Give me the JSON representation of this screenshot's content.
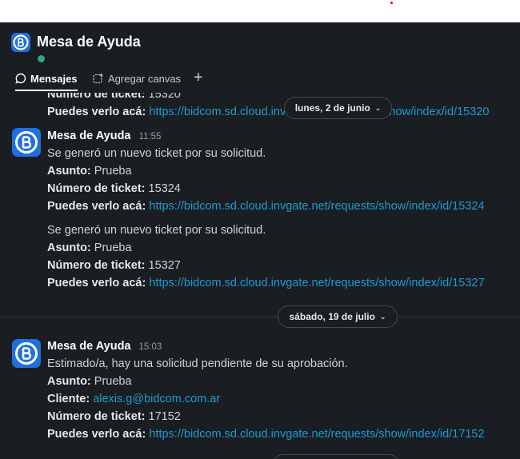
{
  "app": {
    "title": "Mesa de Ayuda"
  },
  "tabs": [
    {
      "label": "Mensajes",
      "icon": "chat-bubble-icon"
    },
    {
      "label": "Agregar canvas",
      "icon": "canvas-icon"
    }
  ],
  "tab_add": "+",
  "partial_message": {
    "ticket_label": "Número de ticket:",
    "ticket_value": "15320",
    "link_label": "Puedes verlo acá:",
    "link_text": "https://bidcom.sd.cloud.inv",
    "link_text_tail": "show/index/id/15320"
  },
  "date_dividers": [
    {
      "label": "lunes, 2 de junio",
      "chevron": "⌄"
    },
    {
      "label": "sábado, 19 de julio",
      "chevron": "⌄"
    }
  ],
  "messages": [
    {
      "sender": "Mesa de Ayuda",
      "time": "11:55",
      "blocks": [
        {
          "intro": "Se generó un nuevo ticket por su solicitud.",
          "subject_label": "Asunto:",
          "subject_value": "Prueba",
          "ticket_label": "Número de ticket:",
          "ticket_value": "15324",
          "link_label": "Puedes verlo acá:",
          "link": "https://bidcom.sd.cloud.invgate.net/requests/show/index/id/15324"
        },
        {
          "intro": "Se generó un nuevo ticket por su solicitud.",
          "subject_label": "Asunto:",
          "subject_value": "Prueba",
          "ticket_label": "Número de ticket:",
          "ticket_value": "15327",
          "link_label": "Puedes verlo acá:",
          "link": "https://bidcom.sd.cloud.invgate.net/requests/show/index/id/15327"
        }
      ]
    },
    {
      "sender": "Mesa de Ayuda",
      "time": "15:03",
      "intro": "Estimado/a, hay una solicitud pendiente de su aprobación.",
      "subject_label": "Asunto:",
      "subject_value": "Prueba",
      "client_label": "Cliente:",
      "client_value": "alexis.g@bidcom.com.ar",
      "ticket_label": "Número de ticket:",
      "ticket_value": "17152",
      "link_label": "Puedes verlo acá:",
      "link": "https://bidcom.sd.cloud.invgate.net/requests/show/index/id/17152"
    }
  ],
  "colors": {
    "background": "#1a1d21",
    "link": "#1d9bd1",
    "brand": "#1f6fe0",
    "presence": "#2bac76"
  }
}
